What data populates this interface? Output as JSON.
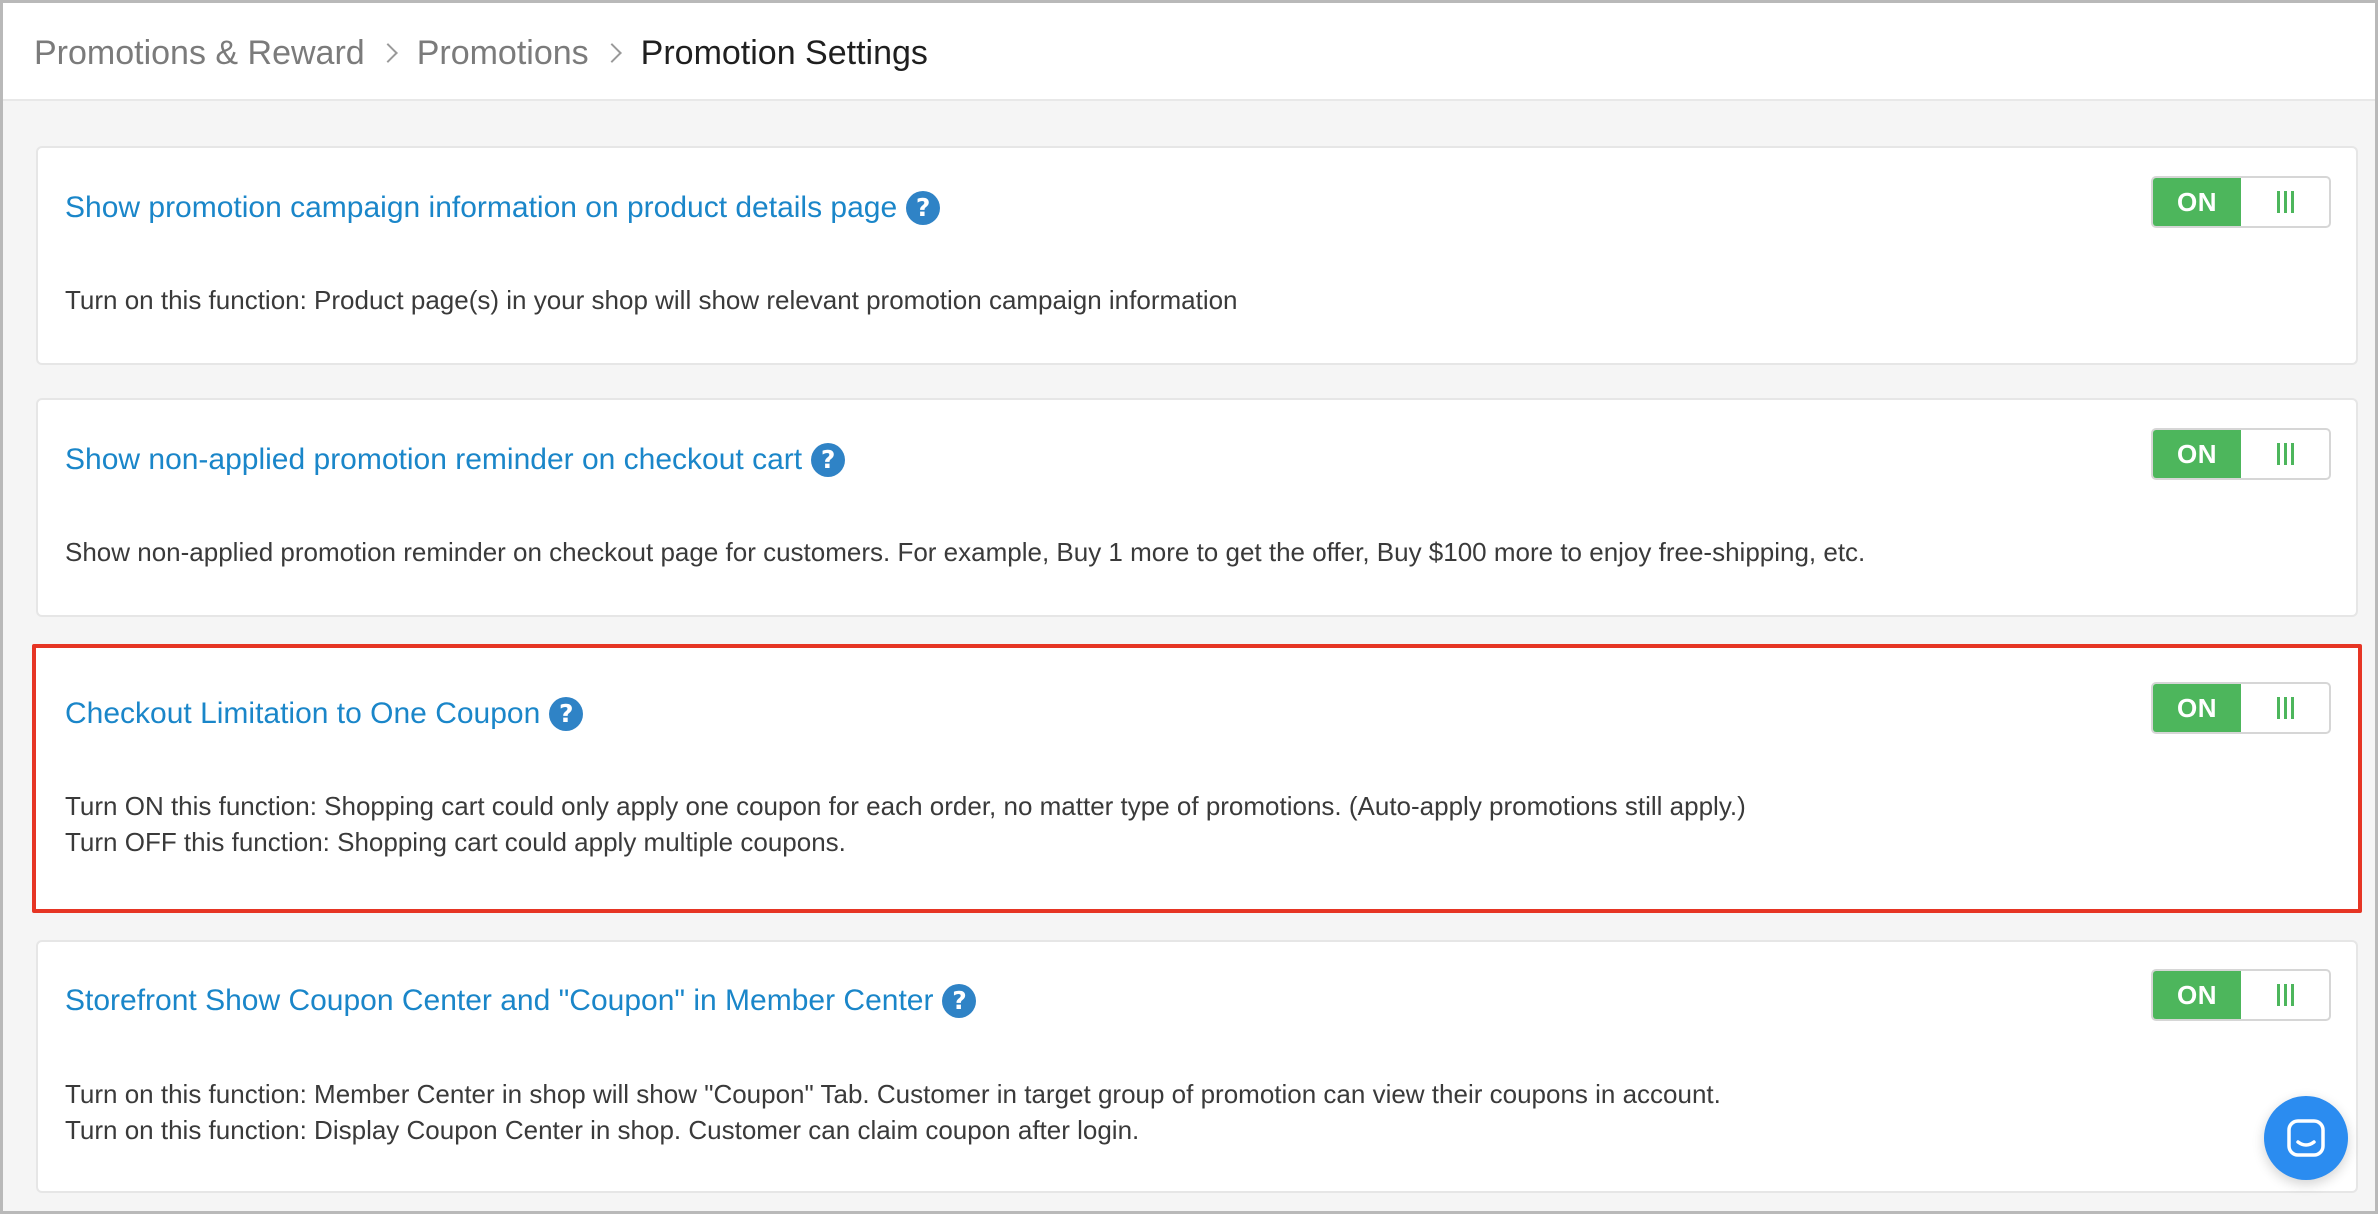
{
  "breadcrumb": {
    "items": [
      "Promotions & Reward",
      "Promotions"
    ],
    "current": "Promotion Settings"
  },
  "settings": [
    {
      "title": "Show promotion campaign information on product details page",
      "help_icon": "?",
      "description_lines": [
        "Turn on this function: Product page(s) in your shop will show relevant promotion campaign information"
      ],
      "toggle_label": "ON",
      "enabled": true
    },
    {
      "title": "Show non-applied promotion reminder on checkout cart",
      "help_icon": "?",
      "description_lines": [
        "Show non-applied promotion reminder on checkout page for customers. For example, Buy 1 more to get the offer, Buy $100 more to enjoy free-shipping, etc."
      ],
      "toggle_label": "ON",
      "enabled": true
    },
    {
      "title": "Checkout Limitation to One Coupon",
      "help_icon": "?",
      "description_lines": [
        "Turn ON this function: Shopping cart could only apply one coupon for each order, no matter type of promotions. (Auto-apply promotions still apply.)",
        "Turn OFF this function: Shopping cart could apply multiple coupons."
      ],
      "toggle_label": "ON",
      "enabled": true,
      "highlighted": true
    },
    {
      "title": "Storefront Show Coupon Center and \"Coupon\" in Member Center",
      "help_icon": "?",
      "description_lines": [
        "Turn on this function: Member Center in shop will show \"Coupon\" Tab. Customer in target group of promotion can view their coupons in account.",
        "Turn on this function: Display Coupon Center in shop. Customer can claim coupon after login."
      ],
      "toggle_label": "ON",
      "enabled": true
    }
  ],
  "colors": {
    "title_link": "#1a86c9",
    "toggle_on": "#4db65c",
    "highlight_border": "#e63524",
    "chat_button": "#2b8cf0"
  },
  "icons": {
    "help": "question-circle-icon",
    "chat": "chat-bubble-icon",
    "separator": "chevron-right-icon"
  }
}
